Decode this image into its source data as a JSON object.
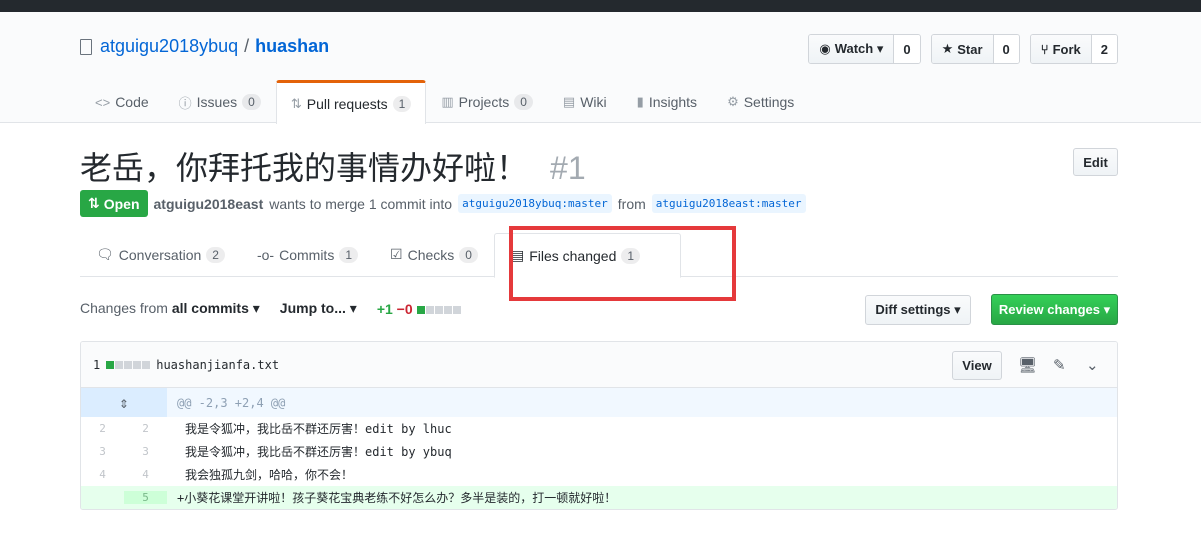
{
  "repo": {
    "owner": "atguigu2018ybuq",
    "separator": "/",
    "name": "huashan"
  },
  "actions": [
    {
      "label": "Watch ▾",
      "icon": "eye-icon",
      "count": "0"
    },
    {
      "label": "Star",
      "icon": "star-icon",
      "count": "0"
    },
    {
      "label": "Fork",
      "icon": "fork-icon",
      "count": "2"
    }
  ],
  "tabs": [
    {
      "label": "Code",
      "icon": "<>",
      "count": ""
    },
    {
      "label": "Issues",
      "icon": "ⓘ",
      "count": "0"
    },
    {
      "label": "Pull requests",
      "icon": "⇅",
      "count": "1"
    },
    {
      "label": "Projects",
      "icon": "▥",
      "count": "0"
    },
    {
      "label": "Wiki",
      "icon": "▤",
      "count": ""
    },
    {
      "label": "Insights",
      "icon": "▮",
      "count": ""
    },
    {
      "label": "Settings",
      "icon": "⚙",
      "count": ""
    }
  ],
  "pr": {
    "title": "老岳，你拜托我的事情办好啦！",
    "number": "#1",
    "edit_label": "Edit",
    "state": "Open",
    "author": "atguigu2018east",
    "merge_text": "wants to merge 1 commit into",
    "base_ref": "atguigu2018ybuq:master",
    "from_text": "from",
    "head_ref": "atguigu2018east:master"
  },
  "pr_tabs": [
    {
      "label": "Conversation",
      "count": "2"
    },
    {
      "label": "Commits",
      "count": "1"
    },
    {
      "label": "Checks",
      "count": "0"
    },
    {
      "label": "Files changed",
      "count": "1"
    }
  ],
  "toolbar": {
    "changes_prefix": "Changes from",
    "changes_value": "all commits ▾",
    "jump_label": "Jump to... ▾",
    "additions": "+1",
    "deletions": "−0",
    "diff_settings": "Diff settings ▾",
    "review_changes": "Review changes ▾"
  },
  "file": {
    "changes_count": "1",
    "name": "huashanjianfa.txt",
    "view_label": "View",
    "hunk_header": "@@ -2,3 +2,4 @@",
    "lines": [
      {
        "old": "2",
        "new": "2",
        "text": "我是令狐冲，我比岳不群还厉害！edit by lhuc"
      },
      {
        "old": "3",
        "new": "3",
        "text": "我是令狐冲，我比岳不群还厉害！edit by ybuq"
      },
      {
        "old": "4",
        "new": "4",
        "text": "我会独孤九剑，哈哈，你不会！"
      }
    ],
    "added_line": {
      "new": "5",
      "text": "+小葵花课堂开讲啦！孩子葵花宝典老练不好怎么办？多半是装的，打一顿就好啦！"
    }
  }
}
